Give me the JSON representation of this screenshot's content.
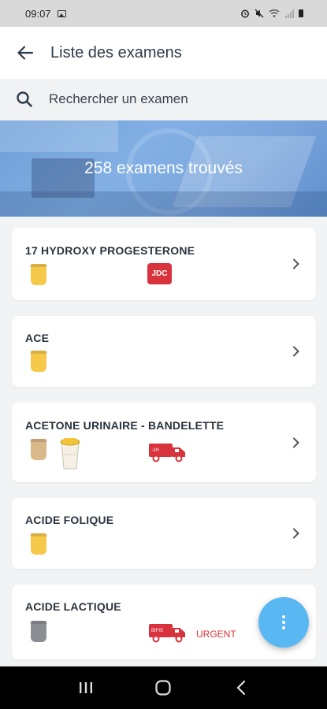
{
  "status_bar": {
    "time": "09:07"
  },
  "header": {
    "title": "Liste des examens",
    "back_icon": "arrow-left-icon"
  },
  "search": {
    "placeholder": "Rechercher un examen",
    "icon": "search-icon"
  },
  "banner": {
    "text": "258 examens trouvés"
  },
  "exams": [
    {
      "name": "17 HYDROXY PROGESTERONE",
      "tubes": [
        "yellow"
      ],
      "badge": "JDC"
    },
    {
      "name": "ACE",
      "tubes": [
        "yellow"
      ]
    },
    {
      "name": "ACETONE URINAIRE - BANDELETTE",
      "tubes": [
        "beige"
      ],
      "container": "urine-cup",
      "truck_label": "-1H"
    },
    {
      "name": "ACIDE FOLIQUE",
      "tubes": [
        "yellow"
      ]
    },
    {
      "name": "ACIDE LACTIQUE",
      "tubes": [
        "grey"
      ],
      "truck_label": "BIFIS",
      "urgent": "URGENT"
    }
  ],
  "colors": {
    "accent": "#59b7f2",
    "alert": "#d8333c",
    "tube_yellow": "#f6c94a",
    "tube_beige": "#d9b88a",
    "tube_grey": "#8b8f93"
  }
}
